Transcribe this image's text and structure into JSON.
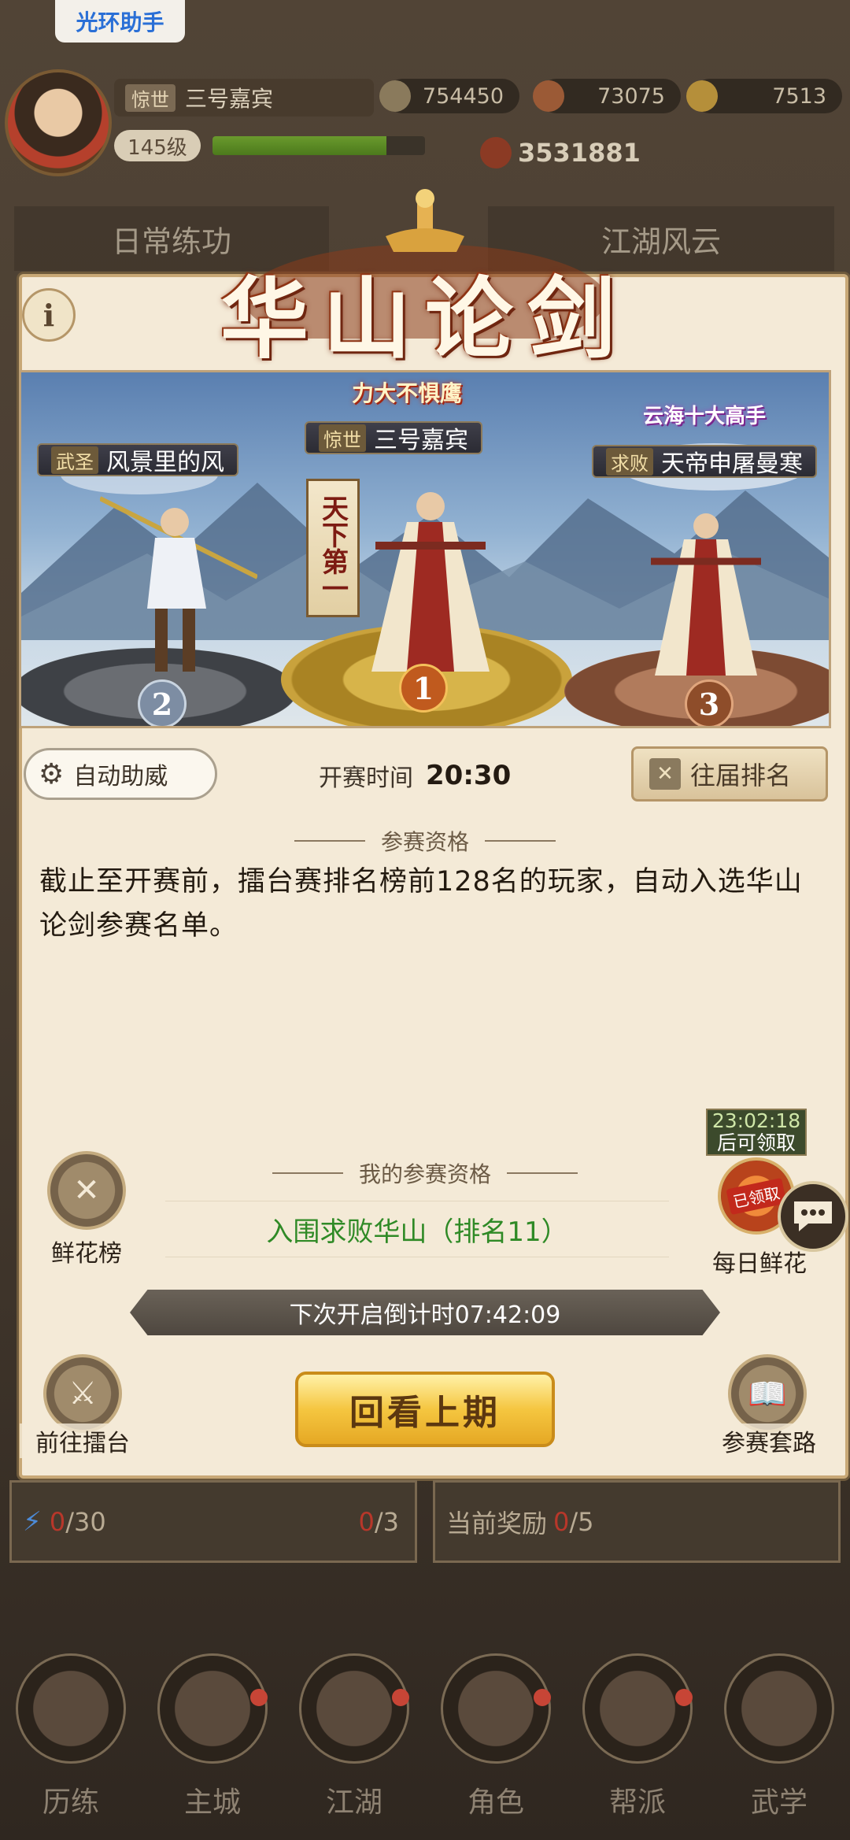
{
  "top_pill": "光环助手",
  "player": {
    "title_tag": "惊世",
    "name": "三号嘉宾",
    "level": "145级",
    "xp_fraction": 0.82
  },
  "resources": [
    {
      "value": "754450"
    },
    {
      "value": "73075"
    },
    {
      "value": "7513"
    }
  ],
  "power": "3531881",
  "bg_tabs": [
    "日常练功",
    "江湖风云"
  ],
  "panel": {
    "title": "华山论剑",
    "info_label": "i",
    "champion_badge": "力大不惧鹰",
    "top10_badge": "云海十大高手",
    "champion_vertical": "天下第一",
    "podium": [
      {
        "rank": "2",
        "tag": "武圣",
        "name": "风景里的风"
      },
      {
        "rank": "1",
        "tag": "惊世",
        "name": "三号嘉宾"
      },
      {
        "rank": "3",
        "tag": "求败",
        "name": "天帝申屠曼寒"
      }
    ],
    "auto_cheer_label": "自动助威",
    "start_time_label": "开赛时间",
    "start_time_value": "20:30",
    "past_rankings_label": "往届排名",
    "qualification_heading": "参赛资格",
    "qualification_text": "截止至开赛前，擂台赛排名榜前128名的玩家，自动入选华山论剑参赛名单。",
    "flower_rank_label": "鲜花榜",
    "my_qualification_heading": "我的参赛资格",
    "my_qualification_value": "入围求败华山（排名11）",
    "daily_flower_timer": "23:02:18",
    "daily_flower_timer_sub": "后可领取",
    "daily_flower_stamp": "已领取",
    "daily_flower_label": "每日鲜花",
    "countdown_text": "下次开启倒计时07:42:09",
    "go_arena_label": "前往擂台",
    "review_label": "回看上期",
    "strategy_label": "参赛套路"
  },
  "lower_cards": [
    {
      "used": "0",
      "total": "/30",
      "extra_used": "0",
      "extra_total": "/3"
    },
    {
      "label": "当前奖励",
      "used": "0",
      "total": "/5"
    }
  ],
  "nav": [
    "历练",
    "主城",
    "江湖",
    "角色",
    "帮派",
    "武学"
  ],
  "colors": {
    "accent_gold": "#f5c640",
    "qual_green": "#2f8a26",
    "panel_bg": "#f4ead7"
  }
}
